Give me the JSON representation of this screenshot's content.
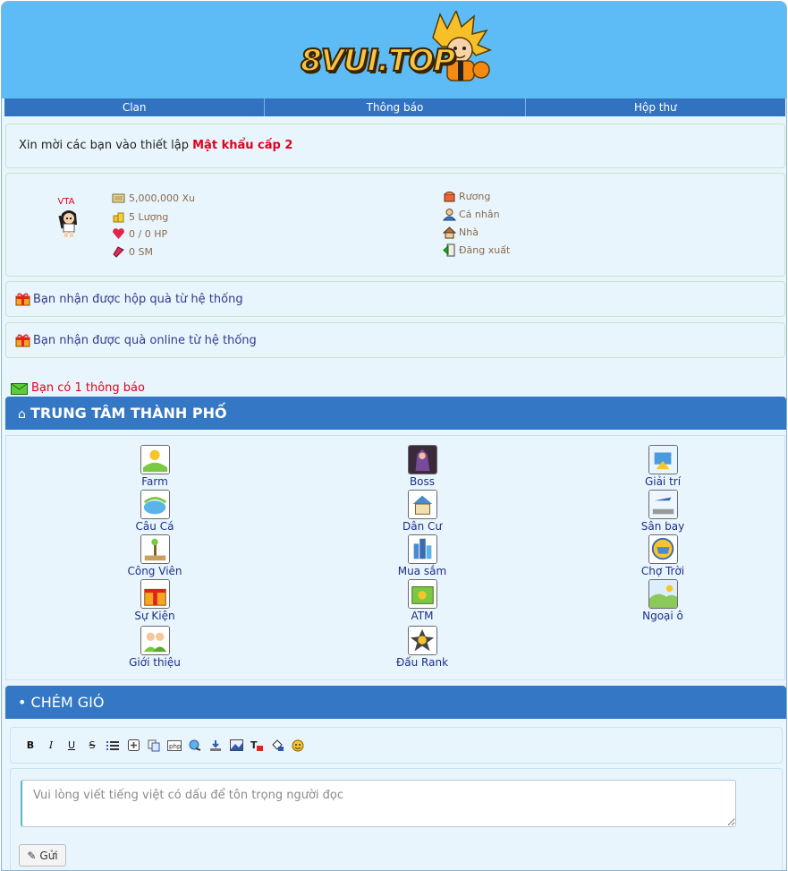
{
  "header": {
    "logo_text": "8VUI.TOP"
  },
  "menu": [
    {
      "label": "Clan"
    },
    {
      "label": "Thông báo"
    },
    {
      "label": "Hộp thư"
    }
  ],
  "notice": {
    "text": "Xin mời các bạn vào thiết lập ",
    "link": "Mật khẩu cấp 2"
  },
  "profile": {
    "name": "VTA",
    "stats": [
      {
        "icon": "coin-icon",
        "text": "5,000,000 Xu"
      },
      {
        "icon": "gold-icon",
        "text": "5 Lượng"
      },
      {
        "icon": "heart-icon",
        "text": "0 / 0 HP"
      },
      {
        "icon": "power-icon",
        "text": "0 SM"
      }
    ],
    "links": [
      {
        "icon": "chest-icon",
        "text": "Rương"
      },
      {
        "icon": "user-icon",
        "text": "Cá nhân"
      },
      {
        "icon": "house-icon",
        "text": "Nhà"
      },
      {
        "icon": "logout-icon",
        "text": "Đăng xuất"
      }
    ]
  },
  "gifts": [
    {
      "text": "Bạn nhận được hộp quà từ hệ thống"
    },
    {
      "text": "Bạn nhận được quà online từ hệ thống"
    }
  ],
  "mail": {
    "text": "Bạn có 1 thông báo"
  },
  "city": {
    "title": "TRUNG TÂM THÀNH PHỐ",
    "items": [
      {
        "label": "Farm",
        "icon": "farm-icon"
      },
      {
        "label": "Boss",
        "icon": "boss-icon"
      },
      {
        "label": "Giải trí",
        "icon": "entertainment-icon"
      },
      {
        "label": "Câu Cá",
        "icon": "fishing-icon"
      },
      {
        "label": "Dân Cư",
        "icon": "residential-icon"
      },
      {
        "label": "Sân bay",
        "icon": "airport-icon"
      },
      {
        "label": "Công Viên",
        "icon": "park-icon"
      },
      {
        "label": "Mua sắm",
        "icon": "shopping-icon"
      },
      {
        "label": "Chợ Trời",
        "icon": "market-icon"
      },
      {
        "label": "Sự Kiện",
        "icon": "event-icon"
      },
      {
        "label": "ATM",
        "icon": "atm-icon"
      },
      {
        "label": "Ngoại ô",
        "icon": "suburb-icon"
      },
      {
        "label": "Giới thiệu",
        "icon": "referral-icon"
      },
      {
        "label": "Đấu Rank",
        "icon": "rank-icon"
      }
    ]
  },
  "chat": {
    "title": "CHÉM GIÓ",
    "toolbar": [
      "B",
      "I",
      "U",
      "S"
    ],
    "placeholder": "Vui lòng viết tiếng việt có dấu để tôn trọng người đọc",
    "send_label": "Gửi"
  },
  "colors": {
    "header_bg": "#5dbcf6",
    "menu_bg": "#3173c0",
    "section_bg": "#3478c5",
    "highlight_red": "#e3001b",
    "link_blue": "#1d2d8a"
  }
}
